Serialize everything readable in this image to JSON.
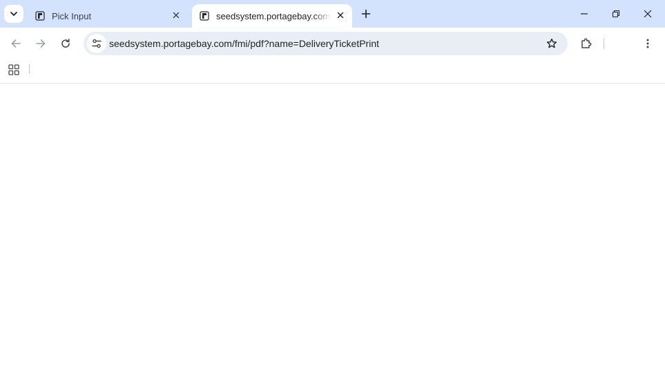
{
  "tabs": [
    {
      "title": "Pick Input",
      "active": false,
      "favicon": "portagebay-favicon-icon"
    },
    {
      "title": "seedsystem.portagebay.com/fmi/pdf?name=DeliveryTicketPrint",
      "active": true,
      "favicon": "portagebay-favicon-icon"
    }
  ],
  "address_bar": {
    "url": "seedsystem.portagebay.com/fmi/pdf?name=DeliveryTicketPrint"
  },
  "icons": {
    "tab_search": "chevron-down-icon",
    "tab_close": "close-icon",
    "new_tab": "plus-icon",
    "minimize": "minimize-icon",
    "restore": "restore-icon",
    "window_close": "close-icon",
    "back": "arrow-left-icon",
    "forward": "arrow-right-icon",
    "reload": "reload-icon",
    "site_info": "tune-icon",
    "bookmark": "star-icon",
    "extensions": "puzzle-icon",
    "menu": "kebab-menu-icon",
    "apps": "apps-grid-icon"
  },
  "colors": {
    "tabstrip": "#d3e3fd",
    "omnibox": "#e9eef6",
    "disabled_icon": "#9aa0a6",
    "icon": "#474747"
  }
}
